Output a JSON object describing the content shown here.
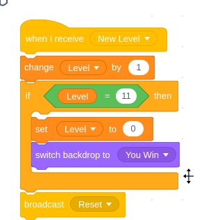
{
  "colors": {
    "events": "#ffbf00",
    "events_dark": "#e6ac00",
    "variables": "#ff8c1a",
    "variables_dark": "#db6e00",
    "control": "#ffab19",
    "control_dark": "#cf8b17",
    "operators": "#59c059",
    "operators_dark": "#389438",
    "looks": "#9966ff",
    "looks_dark": "#774dcb"
  },
  "hat": {
    "label": "when I receive",
    "message": "New Level"
  },
  "change": {
    "label": "change",
    "variable": "Level",
    "by_label": "by",
    "amount": "1"
  },
  "if_block": {
    "label": "if",
    "then_label": "then",
    "condition": {
      "left": "Level",
      "operator": "=",
      "right": "11"
    }
  },
  "set": {
    "label": "set",
    "variable": "Level",
    "to_label": "to",
    "value": "0"
  },
  "switch": {
    "label": "switch backdrop to",
    "backdrop": "You Win"
  },
  "broadcast": {
    "label": "broadcast",
    "message": "Reset"
  },
  "cursor": "move-cursor-icon"
}
